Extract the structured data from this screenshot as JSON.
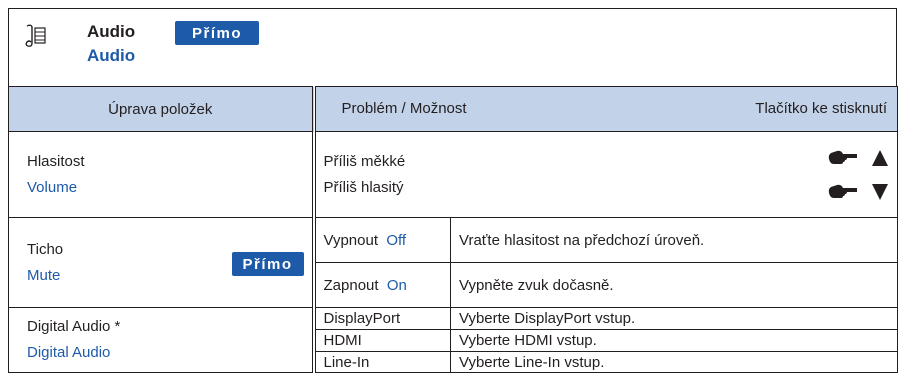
{
  "header": {
    "title": "Audio",
    "subtitle": "Audio",
    "badge": "Přímo"
  },
  "table": {
    "headers": {
      "item": "Úprava položek",
      "problem": "Problém / Možnost",
      "button": "Tlačítko ke stisknutí"
    },
    "volume": {
      "label": "Hlasitost",
      "label_en": "Volume",
      "problem_soft": "Příliš měkké",
      "problem_loud": "Příliš hlasitý"
    },
    "mute": {
      "label": "Ticho",
      "label_en": "Mute",
      "badge": "Přímo",
      "off_label": "Vypnout",
      "off_value": "Off",
      "off_desc": "Vraťte hlasitost na předchozí úroveň.",
      "on_label": "Zapnout",
      "on_value": "On",
      "on_desc": "Vypněte zvuk dočasně."
    },
    "digital_audio": {
      "label": "Digital Audio *",
      "label_en": "Digital Audio",
      "options": [
        {
          "name": "DisplayPort",
          "desc": "Vyberte DisplayPort vstup."
        },
        {
          "name": "HDMI",
          "desc": "Vyberte HDMI vstup."
        },
        {
          "name": "Line-In",
          "desc": "Vyberte Line-In vstup."
        }
      ]
    }
  },
  "colors": {
    "accent_blue": "#1d5aa8",
    "header_fill": "#c2d2e8"
  },
  "icons": [
    "music-note-icon",
    "hand-pointer-icon",
    "arrow-up-icon",
    "arrow-down-icon"
  ]
}
